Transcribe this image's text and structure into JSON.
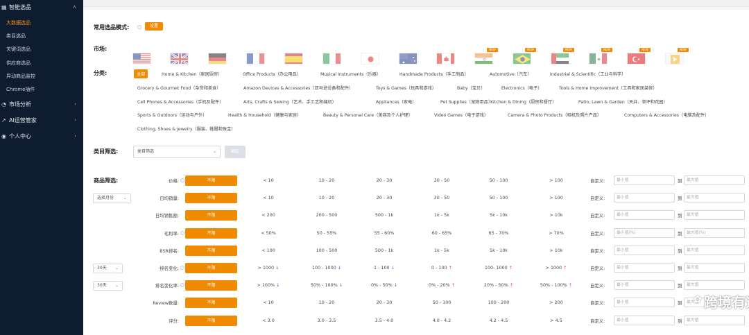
{
  "sidebar": {
    "head": "智能选品",
    "items": [
      {
        "label": "大数据选品",
        "active": true
      },
      {
        "label": "类目选品",
        "active": false
      },
      {
        "label": "关键词选品",
        "active": false
      },
      {
        "label": "供应商选品",
        "active": false
      },
      {
        "label": "异动商品监控",
        "active": false
      },
      {
        "label": "Chrome插件",
        "active": false
      }
    ],
    "groups": [
      {
        "label": "市场分析",
        "icon": "chart-icon"
      },
      {
        "label": "AI运营管家",
        "icon": "trend-icon"
      },
      {
        "label": "个人中心",
        "icon": "user-icon"
      }
    ]
  },
  "mode": {
    "label": "常用选品模式:",
    "button": "设置"
  },
  "market": {
    "label": "市场:",
    "flags": [
      "US",
      "UK",
      "DE",
      "FR",
      "ES",
      "IT",
      "JP",
      "AU",
      "CA",
      "IN",
      "BR",
      "AE",
      "MX",
      "TR",
      "NL"
    ],
    "new_badge": "NEW"
  },
  "category": {
    "label": "分类:",
    "rows": [
      [
        "全部",
        "Home & Kitchen（家居厨房）",
        "Office Products（办公用品）",
        "Musical Instruments（乐器）",
        "Handmade Products（手工制品）",
        "Automotive（汽车）",
        "Industrial & Scientific（工业与科学）"
      ],
      [
        "Grocery & Gourmet Food（杂货和美食）",
        "Amazon Devices & Accessories（亚马逊设备和配件）",
        "Toys & Games（玩具和游戏）",
        "Baby（宝贝）",
        "Electronics（电子）",
        "Tools & Home Improvement（工具和家居装修）"
      ],
      [
        "Cell Phones & Accessories（手机及配件）",
        "Arts, Crafts & Sewing（艺术、手工艺和缝纫）",
        "Appliances（家电）",
        "Pet Supplies（宠物用品）",
        "Kitchen & Dining（厨房和餐厅）",
        "Patio, Lawn & Garden（天井、草坪和花园）"
      ],
      [
        "Sports & Outdoors（运动与户外）",
        "Health & Household（健康与家居）",
        "Beauty & Personal Care（美容及个人护理）",
        "Video Games（电子游戏）",
        "Camera & Photo Products（相机及照片产品）",
        "Computers & Accessories（电脑及配件）"
      ],
      [
        "Clothing, Shoes & Jewelry（服装、鞋履和珠宝）"
      ]
    ]
  },
  "filter_cat": {
    "label": "类目筛选:",
    "select": "类目筛选",
    "button": "确定"
  },
  "product": {
    "label": "商品筛选:",
    "unlimited": "不限",
    "custom_label": "自定义:",
    "to": "到",
    "rows": [
      {
        "name": "价格:",
        "info": true,
        "side": "",
        "opts": [
          "< 10",
          "10 - 20",
          "20 - 30",
          "30 - 50",
          "50 - 100",
          "> 100"
        ],
        "min": "最小值",
        "max": "最大值"
      },
      {
        "name": "日均销量:",
        "info": false,
        "side": "选择月份",
        "opts": [
          "< 10",
          "10 - 20",
          "20 - 30",
          "30 - 50",
          "50 - 100",
          "> 100"
        ],
        "min": "最小值",
        "max": "最大值"
      },
      {
        "name": "日均销售额:",
        "info": false,
        "side": "",
        "opts": [
          "< 200",
          "200 - 500",
          "500 - 1k",
          "1k - 5k",
          "5k - 10k",
          "> 10k"
        ],
        "min": "最小值",
        "max": "最大值"
      },
      {
        "name": "毛利率:",
        "info": true,
        "side": "",
        "opts": [
          "< 50%",
          "50 - 55%",
          "55 - 60%",
          "60 - 65%",
          "65 - 70%",
          "> 70%"
        ],
        "min": "最小值(%)",
        "max": "最大值(%)"
      },
      {
        "name": "BSR排名:",
        "info": false,
        "side": "",
        "opts": [
          "< 100",
          "100 - 500",
          "500 - 1k",
          "1k - 5k",
          "5k - 10k",
          "> 10k"
        ],
        "min": "最小值",
        "max": "最大值"
      },
      {
        "name": "排名变化:",
        "info": true,
        "side": "30天",
        "opts": [
          "> 1000 ↓",
          "100 - 1000 ↓",
          "1 - 100 ↓",
          "0 - 100 ↑",
          "100- 1000 ↑",
          "> 1000 ↑"
        ],
        "min": "最小值",
        "max": "最大值"
      },
      {
        "name": "排名变化率:",
        "info": true,
        "side": "30天",
        "opts": [
          "> 100% ↓",
          "50% - 100% ↓",
          "0% - 50% ↓",
          "0% - 20% ↑",
          "20% - 50% ↑",
          "50% - 100% ↑"
        ],
        "min": "最小值",
        "max": "最大值"
      },
      {
        "name": "Review数量:",
        "info": false,
        "side": "",
        "opts": [
          "< 10",
          "10 - 20",
          "20 - 30",
          "50 - 100",
          "100 - 200",
          "> 200"
        ],
        "min": "最小值",
        "max": "最大值"
      },
      {
        "name": "评分:",
        "info": false,
        "side": "",
        "opts": [
          "< 3.0",
          "3.0 - 3.5",
          "3.5 - 4.0",
          "4.0 - 4.2",
          "4.2 - 4.5",
          "> 4.5"
        ],
        "min": "最小值",
        "max": "最大值"
      }
    ]
  },
  "watermark": "跨境有道",
  "colors": {
    "accent": "#f08a00",
    "sidebar": "#0e1c2f",
    "active_text": "#f39519"
  }
}
